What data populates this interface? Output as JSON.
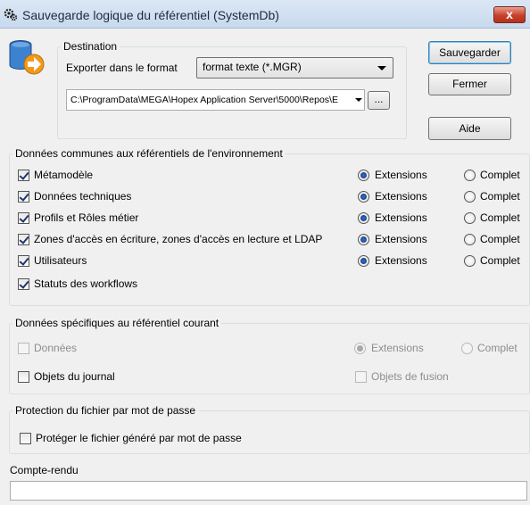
{
  "window": {
    "title": "Sauvegarde logique du référentiel (SystemDb)",
    "close_glyph": "x",
    "icon": "gears-icon"
  },
  "destination": {
    "legend": "Destination",
    "format_label": "Exporter dans le format",
    "format_value": "format texte (*.MGR)",
    "path_value": "C:\\ProgramData\\MEGA\\Hopex Application Server\\5000\\Repos\\E",
    "browse_label": "..."
  },
  "buttons": {
    "save": "Sauvegarder",
    "close": "Fermer",
    "help": "Aide"
  },
  "common": {
    "legend": "Données communes aux référentiels de l'environnement",
    "extensions_label": "Extensions",
    "complet_label": "Complet",
    "items": [
      {
        "label": "Métamodèle",
        "checked": true,
        "mode": "Extensions"
      },
      {
        "label": "Données techniques",
        "checked": true,
        "mode": "Extensions"
      },
      {
        "label": "Profils et Rôles métier",
        "checked": true,
        "mode": "Extensions"
      },
      {
        "label": "Zones d'accès en écriture, zones d'accès en lecture et LDAP",
        "checked": true,
        "mode": "Extensions"
      },
      {
        "label": "Utilisateurs",
        "checked": true,
        "mode": "Extensions"
      },
      {
        "label": "Statuts des workflows",
        "checked": true
      }
    ]
  },
  "specific": {
    "legend": "Données spécifiques au référentiel courant",
    "donnees_label": "Données",
    "extensions_label": "Extensions",
    "complet_label": "Complet",
    "journal_label": "Objets du journal",
    "fusion_label": "Objets de fusion"
  },
  "protection": {
    "legend": "Protection du fichier par mot de passe",
    "protect_label": "Protéger le fichier généré par mot de passe"
  },
  "report": {
    "label": "Compte-rendu",
    "value": ""
  }
}
